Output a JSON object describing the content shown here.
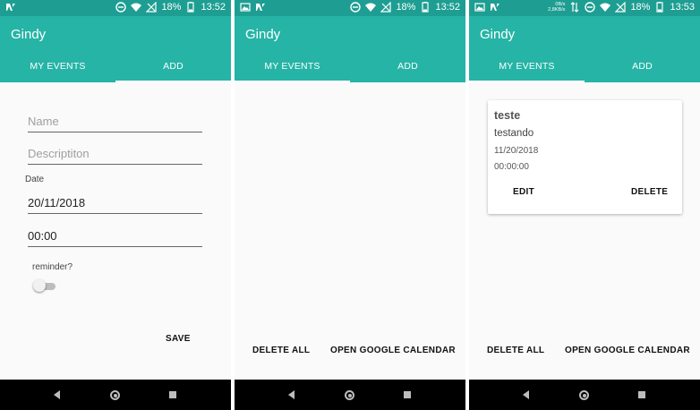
{
  "colors": {
    "status_bar": "#1e9e92",
    "app_bar": "#26b4a6",
    "background": "#fafafa",
    "nav_bar": "#000000"
  },
  "app_title": "Gindy",
  "tabs": {
    "events": "MY EVENTS",
    "add": "ADD"
  },
  "screens": [
    {
      "status": {
        "battery": "18%",
        "time": "13:52"
      },
      "active_tab": "add",
      "form": {
        "name_placeholder": "Name",
        "description_placeholder": "Descriptiton",
        "date_label": "Date",
        "date_value": "20/11/2018",
        "time_value": "00:00",
        "reminder_label": "reminder?",
        "reminder_on": false,
        "save_label": "SAVE"
      }
    },
    {
      "status": {
        "battery": "18%",
        "time": "13:52"
      },
      "active_tab": "events",
      "actions": {
        "delete_all": "DELETE ALL",
        "open_calendar": "OPEN GOOGLE CALENDAR"
      }
    },
    {
      "status": {
        "speed_top": "0B/s",
        "speed_bottom": "2,8KB/s",
        "battery": "18%",
        "time": "13:53"
      },
      "active_tab": "events",
      "card": {
        "title": "teste",
        "description": "testando",
        "date": "11/20/2018",
        "time": "00:00:00",
        "edit_label": "EDIT",
        "delete_label": "DELETE"
      },
      "actions": {
        "delete_all": "DELETE ALL",
        "open_calendar": "OPEN GOOGLE CALENDAR"
      }
    }
  ]
}
